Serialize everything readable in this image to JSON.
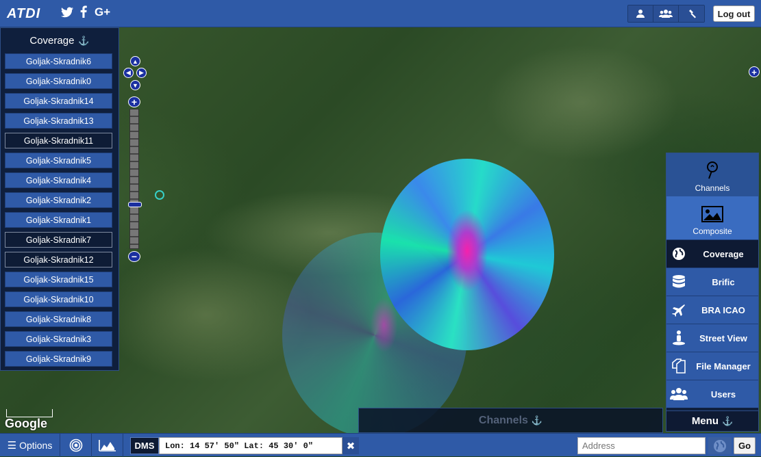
{
  "app": {
    "logo": "ATDI"
  },
  "header": {
    "social": [
      "twitter-icon",
      "facebook-icon",
      "google-plus-icon"
    ],
    "tool_buttons": [
      "user-icon",
      "users-icon",
      "hammer-icon"
    ],
    "logout_label": "Log out"
  },
  "coverage_panel": {
    "title": "Coverage",
    "items": [
      {
        "label": "Goljak-Skradnik6",
        "selected": false
      },
      {
        "label": "Goljak-Skradnik0",
        "selected": false
      },
      {
        "label": "Goljak-Skradnik14",
        "selected": false
      },
      {
        "label": "Goljak-Skradnik13",
        "selected": false
      },
      {
        "label": "Goljak-Skradnik11",
        "selected": true
      },
      {
        "label": "Goljak-Skradnik5",
        "selected": false
      },
      {
        "label": "Goljak-Skradnik4",
        "selected": false
      },
      {
        "label": "Goljak-Skradnik2",
        "selected": false
      },
      {
        "label": "Goljak-Skradnik1",
        "selected": false
      },
      {
        "label": "Goljak-Skradnik7",
        "selected": true
      },
      {
        "label": "Goljak-Skradnik12",
        "selected": true
      },
      {
        "label": "Goljak-Skradnik15",
        "selected": false
      },
      {
        "label": "Goljak-Skradnik10",
        "selected": false
      },
      {
        "label": "Goljak-Skradnik8",
        "selected": false
      },
      {
        "label": "Goljak-Skradnik3",
        "selected": false
      },
      {
        "label": "Goljak-Skradnik9",
        "selected": false
      }
    ]
  },
  "right_menu": {
    "top_items": [
      {
        "label": "Channels",
        "icon": "channel-pin-icon"
      },
      {
        "label": "Composite",
        "icon": "image-icon"
      }
    ],
    "items": [
      {
        "label": "Coverage",
        "icon": "globe-icon",
        "selected": true
      },
      {
        "label": "Brific",
        "icon": "database-icon",
        "selected": false
      },
      {
        "label": "BRA ICAO",
        "icon": "airplane-icon",
        "selected": false
      },
      {
        "label": "Street View",
        "icon": "pegman-icon",
        "selected": false
      },
      {
        "label": "File Manager",
        "icon": "files-icon",
        "selected": false
      },
      {
        "label": "Users",
        "icon": "users-icon",
        "selected": false
      }
    ],
    "footer": "Menu"
  },
  "channels_tab": {
    "label": "Channels"
  },
  "map": {
    "attribution": "Google"
  },
  "bottombar": {
    "options_label": "Options",
    "dms_label": "DMS",
    "coordinates": "Lon: 14 57' 50\" Lat: 45 30' 0\"",
    "address_placeholder": "Address",
    "go_label": "Go"
  }
}
